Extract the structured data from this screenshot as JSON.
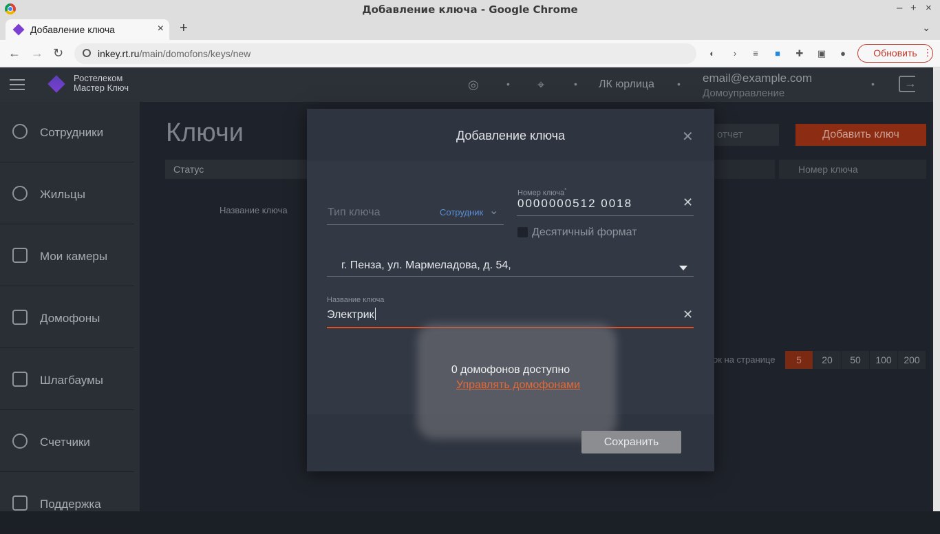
{
  "browser": {
    "window_title": "Добавление ключа - Google Chrome",
    "tab_title": "Добавление ключа",
    "url_host": "inkey.rt.ru",
    "url_path": "/main/domofons/keys/new",
    "update_button": "Обновить"
  },
  "header": {
    "brand_line1": "Ростелеком",
    "brand_line2": "Мастер Ключ",
    "account_type": "ЛК юрлица",
    "email": "email@example.com",
    "subtitle": "Домоуправление"
  },
  "sidebar": {
    "items": [
      {
        "label": "Сотрудники"
      },
      {
        "label": "Жильцы"
      },
      {
        "label": "Мои камеры"
      },
      {
        "label": "Домофоны"
      },
      {
        "label": "Шлагбаумы"
      },
      {
        "label": "Счетчики"
      },
      {
        "label": "Поддержка"
      }
    ]
  },
  "page": {
    "title": "Ключи",
    "status_filter": "Статус",
    "column_key_name": "Название ключа",
    "report_button": "отчет",
    "add_key_button": "Добавить ключ",
    "search_placeholder": "Номер ключа",
    "per_page_label": "ок на странице",
    "per_page_options": [
      "5",
      "20",
      "50",
      "100",
      "200"
    ],
    "per_page_selected": "5"
  },
  "modal": {
    "title": "Добавление ключа",
    "key_type_placeholder": "Тип ключа",
    "key_type_value": "Сотрудник",
    "key_number_label": "Номер ключа",
    "key_number_value": "0000000512 0018",
    "decimal_format_label": "Десятичный формат",
    "address_value": "г. Пенза, ул. Мармеладова, д. 54,",
    "key_name_label": "Название ключа",
    "key_name_value": "Электрик",
    "domofons_available": "0 домофонов доступно",
    "manage_domofons_link": "Управлять домофонами",
    "save_button": "Сохранить"
  },
  "colors": {
    "accent": "#d9542b",
    "link": "#e06a3a",
    "type_value": "#5b8fd6"
  }
}
